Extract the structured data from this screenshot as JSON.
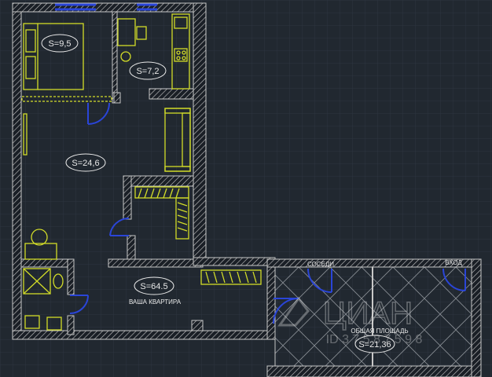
{
  "plan": {
    "rooms": [
      {
        "id": "bedroom",
        "area_label": "S=9,5"
      },
      {
        "id": "kitchen",
        "area_label": "S=7,2"
      },
      {
        "id": "living",
        "area_label": "S=24,6"
      },
      {
        "id": "apartment",
        "area_label": "S=64.5",
        "caption": "ВАША КВАРТИРА"
      },
      {
        "id": "common",
        "area_label": "S=21,36",
        "caption": "ОБЩАЯ ПЛОЩАДЬ"
      }
    ],
    "door_labels": {
      "neighbors": "СОСЕДИ",
      "entrance": "ВХОД"
    },
    "watermark": {
      "brand": "ЦИАН",
      "id_text": "ID 3 7 5 8 7 5 9 8"
    },
    "colors": {
      "background": "#212830",
      "grid": "#2d3540",
      "wall": "#c8c8c8",
      "furniture": "#d2dc28",
      "door": "#2a45d8",
      "window": "#2a45d8",
      "label": "#e8e8e8"
    }
  }
}
